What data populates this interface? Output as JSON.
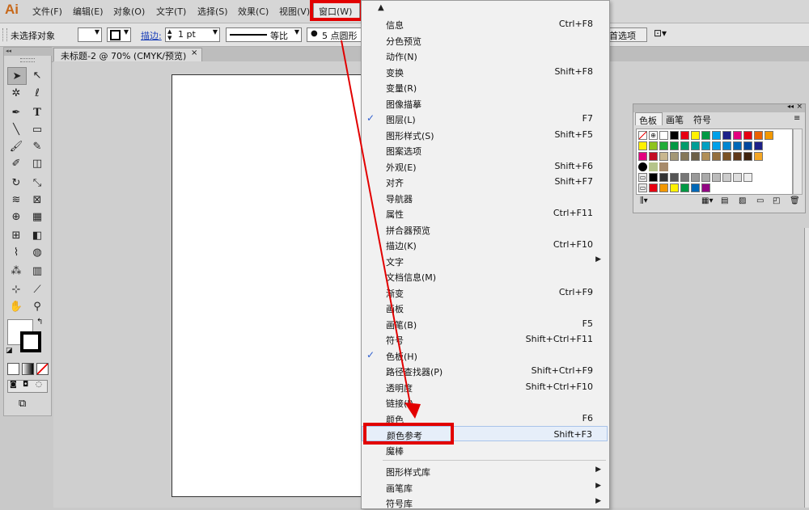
{
  "app": {
    "logo": "Ai"
  },
  "menubar": {
    "items": [
      {
        "label": "文件(F)"
      },
      {
        "label": "编辑(E)"
      },
      {
        "label": "对象(O)"
      },
      {
        "label": "文字(T)"
      },
      {
        "label": "选择(S)"
      },
      {
        "label": "效果(C)"
      },
      {
        "label": "视图(V)"
      },
      {
        "label": "窗口(W)"
      }
    ]
  },
  "control": {
    "selection": "未选择对象",
    "stroke_label": "描边:",
    "stroke_weight": "1 pt",
    "uniform": "等比",
    "brush": "5 点圆形",
    "prefs": "首选项"
  },
  "document": {
    "tab_title": "未标题-2 @ 70% (CMYK/预览)"
  },
  "swatch_panel": {
    "tabs": [
      "色板",
      "画笔",
      "符号"
    ],
    "colors": {
      "row1": [
        "#ffffff",
        "#000000",
        "#e60012",
        "#fff100",
        "#009944",
        "#00a0e9",
        "#1d2088",
        "#e4007f",
        "#e60012",
        "#eb6100",
        "#f39800",
        "#f8b500"
      ],
      "row2": [
        "#fff100",
        "#8fc31f",
        "#22ac38",
        "#009944",
        "#009b6b",
        "#009e96",
        "#00a0c1",
        "#00a0e9",
        "#0086d1",
        "#0068b7",
        "#00479d",
        "#1d2088"
      ],
      "row3": [
        "#e4007f",
        "#c30d23",
        "#c9b78f",
        "#a39775",
        "#867859",
        "#6c5f46",
        "#b18f57",
        "#946f3d",
        "#7a5225",
        "#60391a",
        "#3f230d",
        "#f39800"
      ],
      "row5": [
        "#000000",
        "#333333",
        "#555555",
        "#777777",
        "#999999",
        "#aaaaaa",
        "#bbbbbb",
        "#cccccc",
        "#dddddd",
        "#eeeeee"
      ],
      "row6": [
        "#e60012",
        "#f39800",
        "#fff100",
        "#009944",
        "#0068b7",
        "#920783"
      ]
    }
  },
  "window_menu": {
    "items": [
      {
        "label": "信息",
        "shortcut": "Ctrl+F8"
      },
      {
        "label": "分色预览",
        "shortcut": ""
      },
      {
        "label": "动作(N)",
        "shortcut": ""
      },
      {
        "label": "变换",
        "shortcut": "Shift+F8"
      },
      {
        "label": "变量(R)",
        "shortcut": ""
      },
      {
        "label": "图像描摹",
        "shortcut": ""
      },
      {
        "label": "图层(L)",
        "shortcut": "F7",
        "checked": true
      },
      {
        "label": "图形样式(S)",
        "shortcut": "Shift+F5"
      },
      {
        "label": "图案选项",
        "shortcut": ""
      },
      {
        "label": "外观(E)",
        "shortcut": "Shift+F6"
      },
      {
        "label": "对齐",
        "shortcut": "Shift+F7"
      },
      {
        "label": "导航器",
        "shortcut": ""
      },
      {
        "label": "属性",
        "shortcut": "Ctrl+F11"
      },
      {
        "label": "拼合器预览",
        "shortcut": ""
      },
      {
        "label": "描边(K)",
        "shortcut": "Ctrl+F10"
      },
      {
        "label": "文字",
        "shortcut": "",
        "submenu": true
      },
      {
        "label": "文档信息(M)",
        "shortcut": ""
      },
      {
        "label": "渐变",
        "shortcut": "Ctrl+F9"
      },
      {
        "label": "画板",
        "shortcut": ""
      },
      {
        "label": "画笔(B)",
        "shortcut": "F5"
      },
      {
        "label": "符号",
        "shortcut": "Shift+Ctrl+F11"
      },
      {
        "label": "色板(H)",
        "shortcut": "",
        "checked": true
      },
      {
        "label": "路径查找器(P)",
        "shortcut": "Shift+Ctrl+F9"
      },
      {
        "label": "透明度",
        "shortcut": "Shift+Ctrl+F10"
      },
      {
        "label": "链接(I)",
        "shortcut": ""
      },
      {
        "label": "颜色",
        "shortcut": "F6"
      },
      {
        "label": "颜色参考",
        "shortcut": "Shift+F3",
        "highlighted": true
      },
      {
        "label": "魔棒",
        "shortcut": ""
      },
      {
        "label": "图形样式库",
        "shortcut": "",
        "submenu": true,
        "group_start": true
      },
      {
        "label": "画笔库",
        "shortcut": "",
        "submenu": true
      },
      {
        "label": "符号库",
        "shortcut": "",
        "submenu": true
      }
    ]
  },
  "annotation_color": "#e20000",
  "icons": {
    "menu_up_arrow": "triangle-up-icon",
    "check": "checkmark-icon",
    "submenu": "chevron-right-icon"
  }
}
